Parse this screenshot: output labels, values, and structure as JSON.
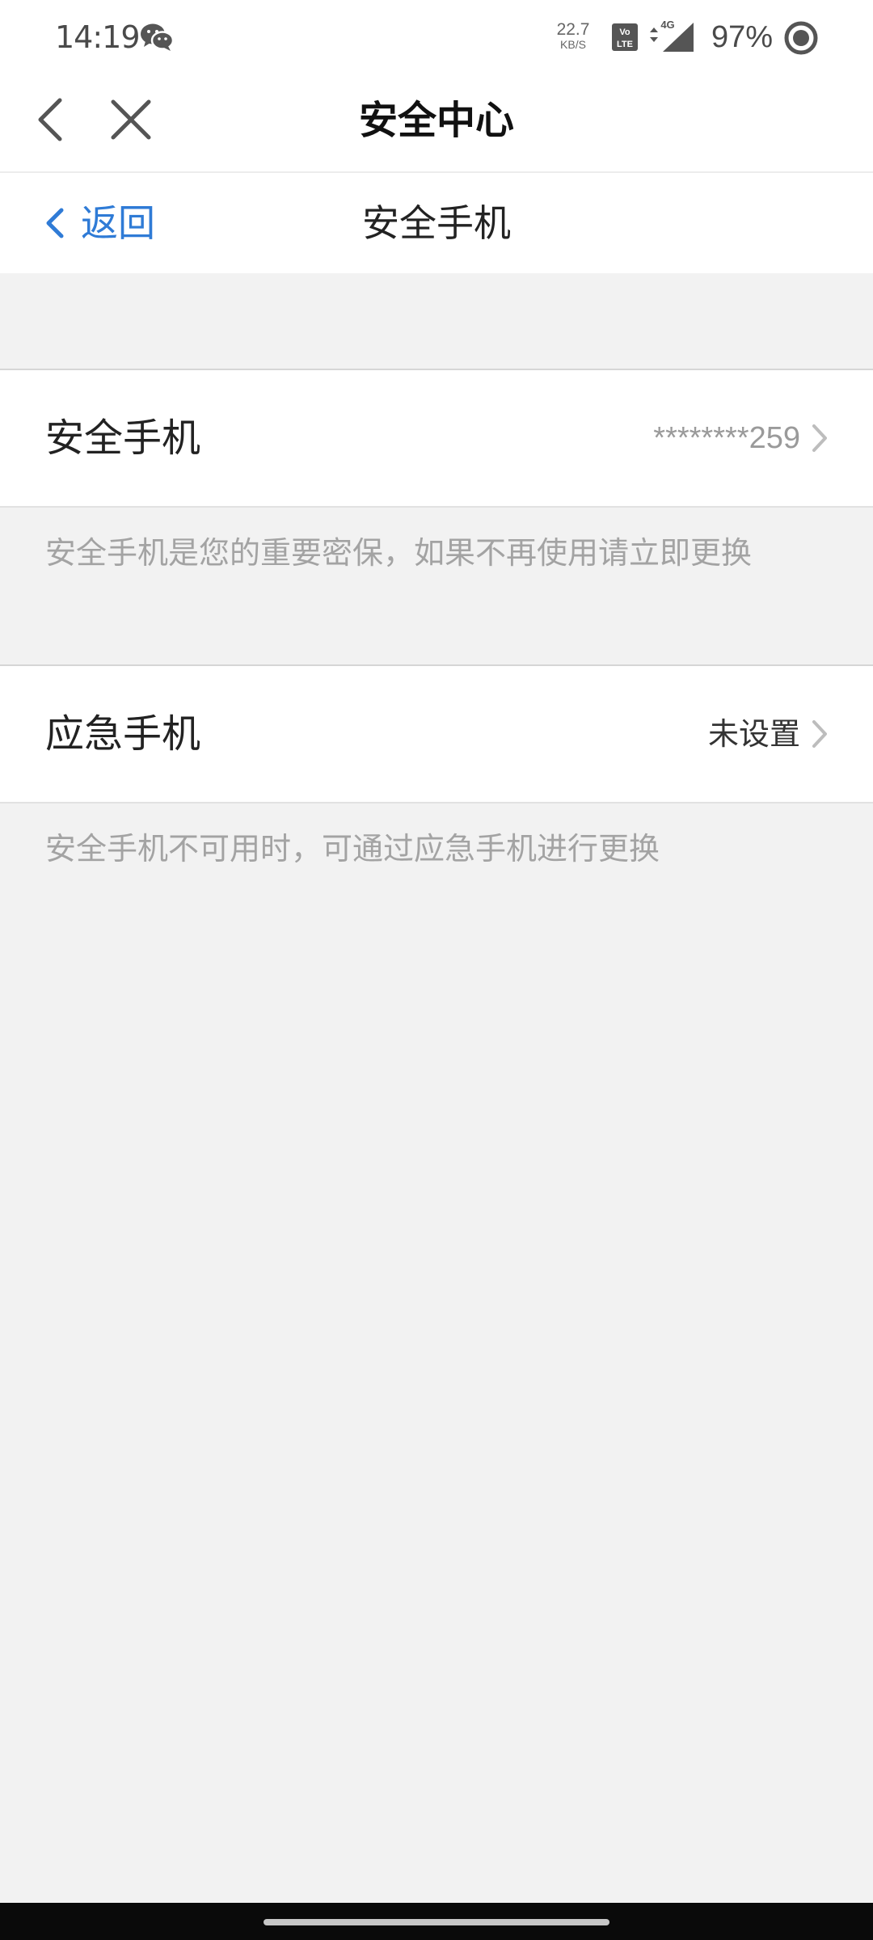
{
  "status_bar": {
    "time": "14:19",
    "net_speed_value": "22.7",
    "net_speed_unit": "KB/S",
    "network_type": "4G",
    "battery": "97%"
  },
  "title_bar": {
    "title": "安全中心"
  },
  "inner_nav": {
    "back_label": "返回",
    "title": "安全手机"
  },
  "rows": [
    {
      "label": "安全手机",
      "value": "********259",
      "hint": "安全手机是您的重要密保，如果不再使用请立即更换"
    },
    {
      "label": "应急手机",
      "value": "未设置",
      "hint": "安全手机不可用时，可通过应急手机进行更换"
    }
  ],
  "colors": {
    "accent_blue": "#2f7bd6",
    "background_gray": "#f2f2f2",
    "hint_gray": "#a3a3a3"
  },
  "icons": {
    "status": [
      "wechat-icon",
      "volte-icon",
      "signal-4g-icon",
      "battery-ring-icon"
    ],
    "title_bar": [
      "back-arrow-icon",
      "close-icon"
    ],
    "rows": [
      "chevron-right-icon"
    ]
  }
}
